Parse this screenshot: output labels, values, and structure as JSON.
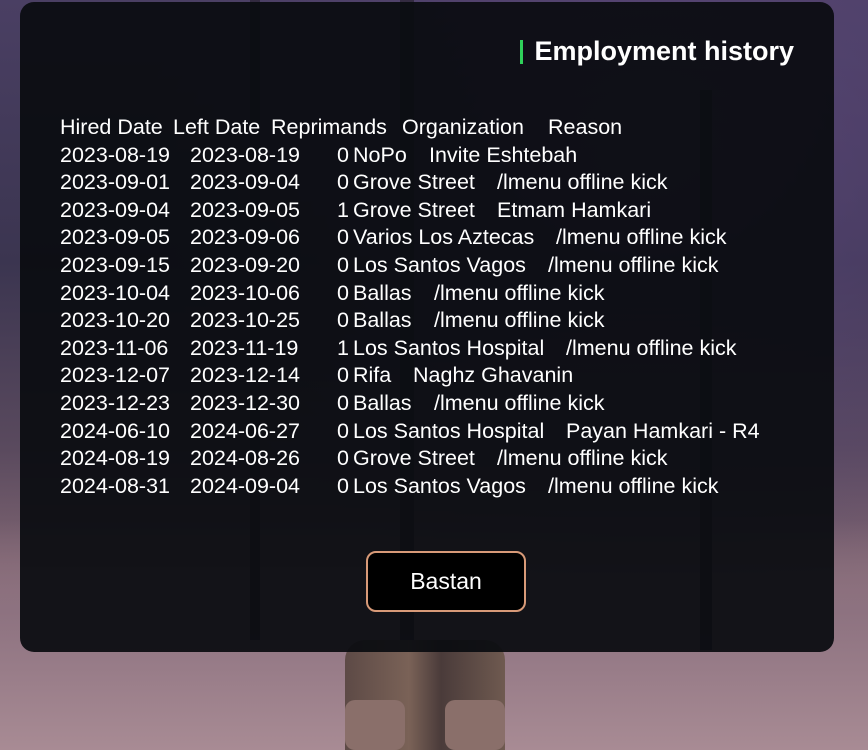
{
  "dialog": {
    "title": "Employment history",
    "columns": {
      "hired": "Hired Date",
      "left": "Left Date",
      "reprimands": "Reprimands",
      "organization": "Organization",
      "reason": "Reason"
    },
    "rows": [
      {
        "hired": "2023-08-19",
        "left": "2023-08-19",
        "reprimands": "0",
        "organization": "NoPo",
        "reason": "Invite Eshtebah"
      },
      {
        "hired": "2023-09-01",
        "left": "2023-09-04",
        "reprimands": "0",
        "organization": "Grove Street",
        "reason": "/lmenu offline kick"
      },
      {
        "hired": "2023-09-04",
        "left": "2023-09-05",
        "reprimands": "1",
        "organization": "Grove Street",
        "reason": "Etmam Hamkari"
      },
      {
        "hired": "2023-09-05",
        "left": "2023-09-06",
        "reprimands": "0",
        "organization": "Varios Los Aztecas",
        "reason": "/lmenu offline kick"
      },
      {
        "hired": "2023-09-15",
        "left": "2023-09-20",
        "reprimands": "0",
        "organization": "Los Santos Vagos",
        "reason": "/lmenu offline kick"
      },
      {
        "hired": "2023-10-04",
        "left": "2023-10-06",
        "reprimands": "0",
        "organization": "Ballas",
        "reason": "/lmenu offline kick"
      },
      {
        "hired": "2023-10-20",
        "left": "2023-10-25",
        "reprimands": "0",
        "organization": "Ballas",
        "reason": "/lmenu offline kick"
      },
      {
        "hired": "2023-11-06",
        "left": "2023-11-19",
        "reprimands": "1",
        "organization": "Los Santos Hospital",
        "reason": "/lmenu offline kick"
      },
      {
        "hired": "2023-12-07",
        "left": "2023-12-14",
        "reprimands": "0",
        "organization": "Rifa",
        "reason": "Naghz Ghavanin"
      },
      {
        "hired": "2023-12-23",
        "left": "2023-12-30",
        "reprimands": "0",
        "organization": "Ballas",
        "reason": "/lmenu offline kick"
      },
      {
        "hired": "2024-06-10",
        "left": "2024-06-27",
        "reprimands": "0",
        "organization": "Los Santos Hospital",
        "reason": "Payan Hamkari - R4"
      },
      {
        "hired": "2024-08-19",
        "left": "2024-08-26",
        "reprimands": "0",
        "organization": "Grove Street",
        "reason": "/lmenu offline kick"
      },
      {
        "hired": "2024-08-31",
        "left": "2024-09-04",
        "reprimands": "0",
        "organization": "Los Santos Vagos",
        "reason": "/lmenu offline kick"
      }
    ],
    "close_button": "Bastan"
  },
  "colors": {
    "accent": "#2fd15a",
    "button_border": "#d89a78",
    "panel": "#0a0c10"
  }
}
